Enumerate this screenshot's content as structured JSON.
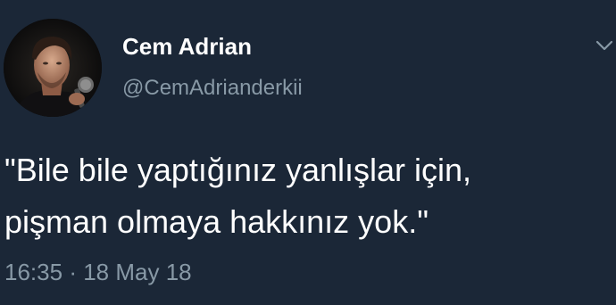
{
  "tweet": {
    "author_name": "Cem Adrian",
    "author_handle": "@CemAdrianderkii",
    "text_line_1": "\"Bile bile yaptığınız yanlışlar için,",
    "text_line_2": "pişman olmaya hakkınız yok.\"",
    "time": "16:35",
    "separator": "·",
    "date": "18 May 18"
  },
  "icons": {
    "avatar": "profile-photo",
    "caret": "chevron-down-icon"
  },
  "colors": {
    "background": "#1b2737",
    "primary_text": "#ffffff",
    "secondary_text": "#8899a6"
  }
}
